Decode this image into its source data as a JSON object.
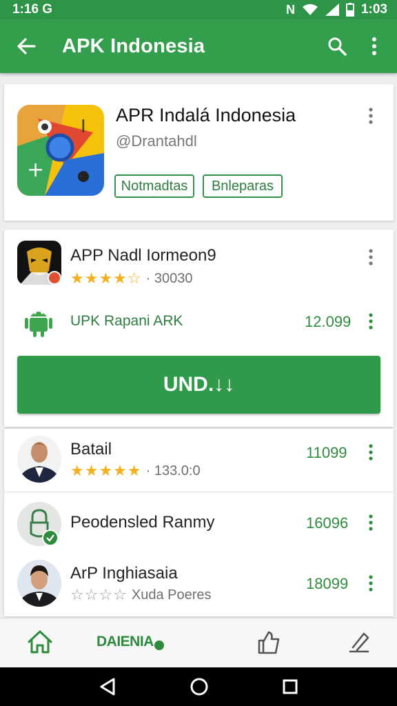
{
  "status": {
    "left_time": "1:16 G",
    "right_time": "1:03"
  },
  "appbar": {
    "title": "APK Indonesia"
  },
  "featured": {
    "title": "APR Indalá Indonesia",
    "handle": "@Drantahdl",
    "chip1": "Notmadtas",
    "chip2": "Bnleparas"
  },
  "app1": {
    "title": "APP Nadl Iormeon9",
    "rating_stars": "★★★★☆",
    "rating_count": "· 30030",
    "sub_label": "UPK Rapani ARK",
    "sub_count": "12.099",
    "install_label": "UND.↓↓"
  },
  "list": [
    {
      "title": "Batail",
      "stars": "★★★★★",
      "meta": "· 133.0:0",
      "count": "11099"
    },
    {
      "title": "Peodensled Ranmy",
      "stars": "",
      "meta": "",
      "count": "16096"
    },
    {
      "title": "ArP Inghiasaia",
      "stars": "☆☆☆☆",
      "meta": "Xuda Poeres",
      "count": "18099"
    }
  ],
  "bottomnav": {
    "label": "DAIENIA"
  },
  "colors": {
    "primary": "#339f4d",
    "accent": "#2e8b3e",
    "star": "#f2b01e"
  }
}
